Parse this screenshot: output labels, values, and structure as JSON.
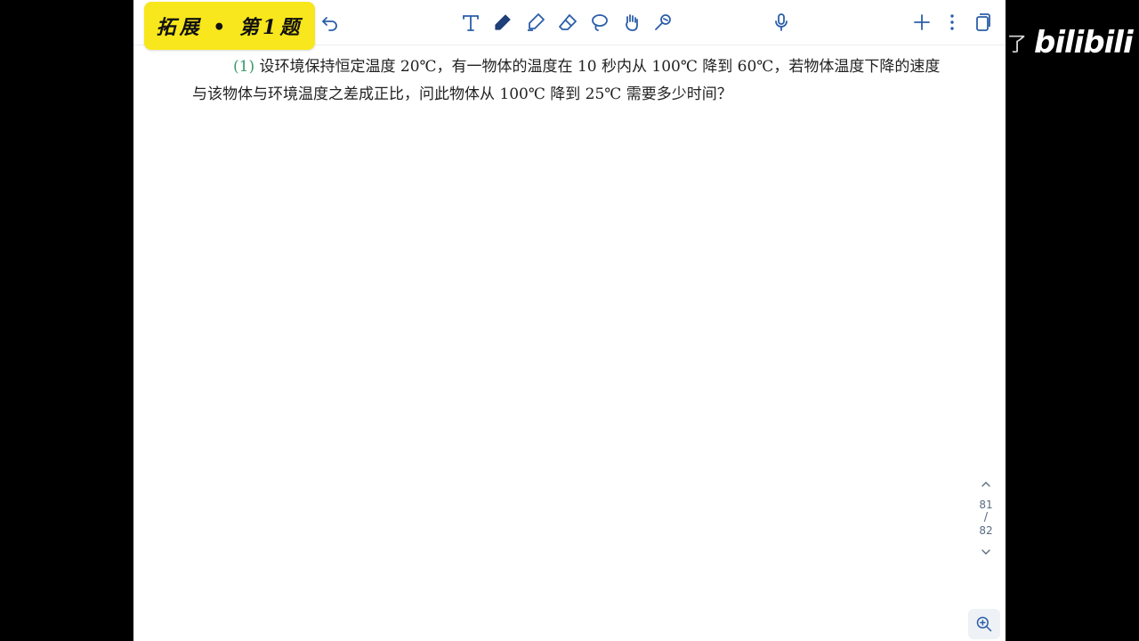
{
  "toolbar": {
    "title": "拓展 • 第1题",
    "tools": [
      {
        "name": "undo-icon"
      },
      {
        "name": "text-tool-icon"
      },
      {
        "name": "pen-tool-icon"
      },
      {
        "name": "highlighter-tool-icon"
      },
      {
        "name": "eraser-tool-icon"
      },
      {
        "name": "lasso-tool-icon"
      },
      {
        "name": "hand-tool-icon"
      },
      {
        "name": "shape-tool-icon"
      },
      {
        "name": "microphone-icon"
      },
      {
        "name": "add-icon"
      },
      {
        "name": "more-icon"
      },
      {
        "name": "pages-icon"
      }
    ]
  },
  "question": {
    "number": "(1)",
    "text": "设环境保持恒定温度 20℃，有一物体的温度在 10 秒内从 100℃ 降到 60℃，若物体温度下降的速度与该物体与环境温度之差成正比，问此物体从 100℃ 降到 25℃ 需要多少时间？"
  },
  "pager": {
    "current": "81",
    "separator": "/",
    "total": "82"
  },
  "watermark": {
    "char": "了",
    "logo": "bilibili"
  },
  "colors": {
    "badge": "#f8e71c",
    "accent": "#2b5ea8",
    "question_number": "#3a9a6a"
  }
}
